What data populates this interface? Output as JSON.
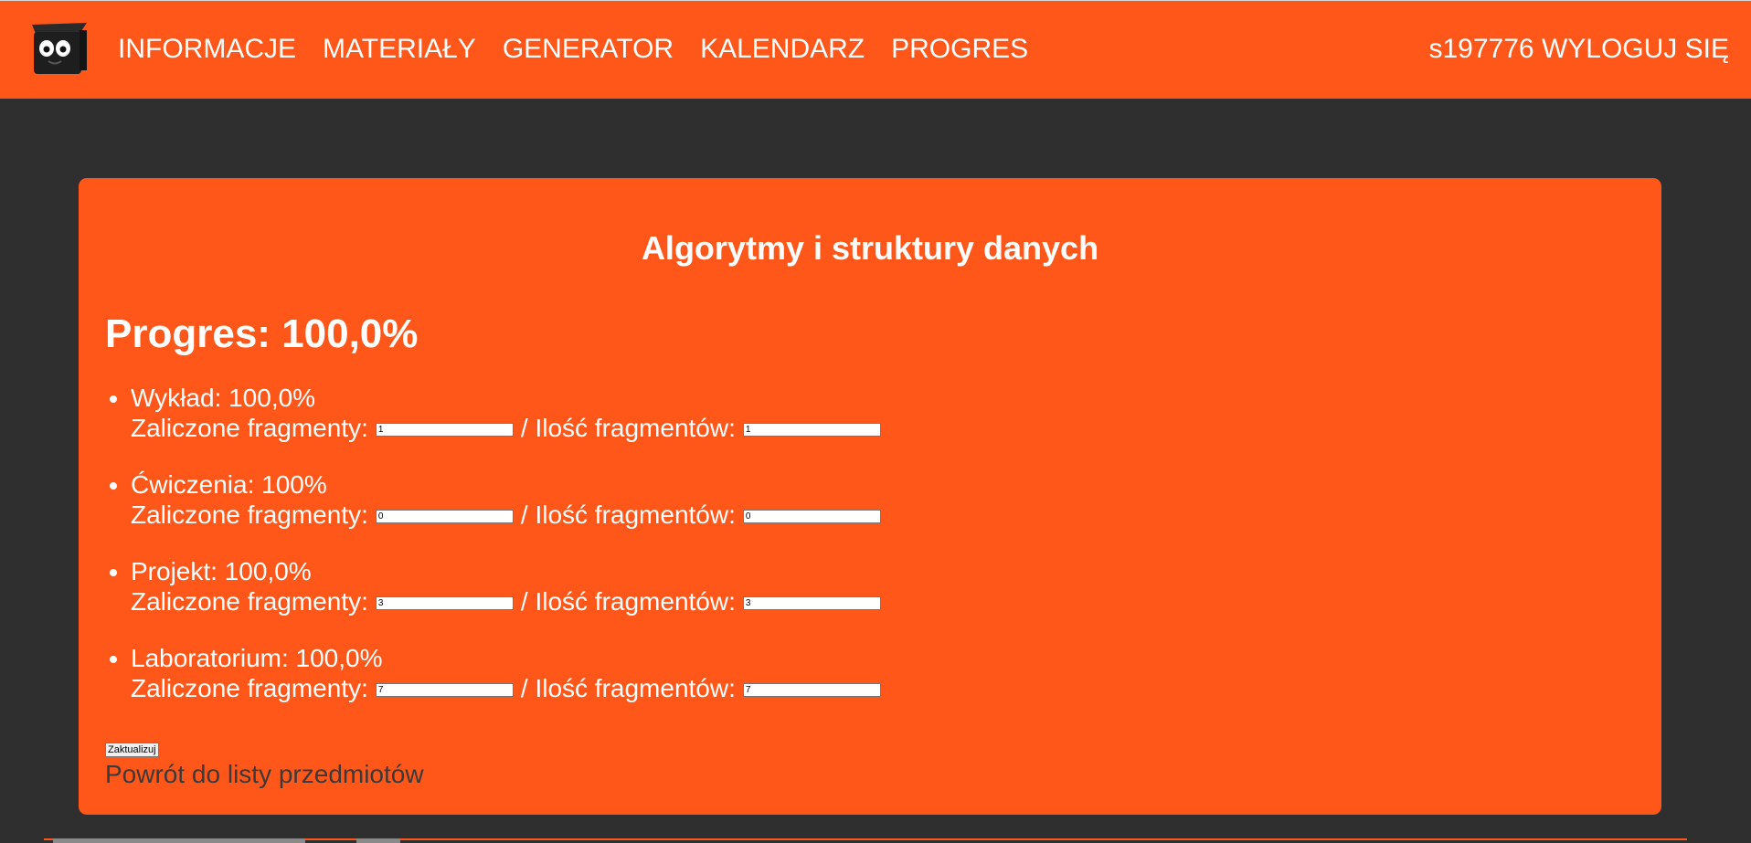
{
  "colors": {
    "accent": "#ff5719",
    "background": "#2f2f2f",
    "text_light": "#ffffff",
    "link_dark": "#3a3a3a"
  },
  "header": {
    "logo_icon": "owl-mascot-icon",
    "nav": [
      {
        "label": "INFORMACJE"
      },
      {
        "label": "MATERIAŁY"
      },
      {
        "label": "GENERATOR"
      },
      {
        "label": "KALENDARZ"
      },
      {
        "label": "PROGRES"
      }
    ],
    "user_id": "s197776",
    "logout_label": "WYLOGUJ SIĘ"
  },
  "course": {
    "title": "Algorytmy i struktury danych",
    "progress_heading": "Progres: 100,0%",
    "completed_label": "Zaliczone fragmenty:",
    "total_label": "/ Ilość fragmentów:",
    "components": [
      {
        "label": "Wykład: 100,0%",
        "completed": "1",
        "total": "1"
      },
      {
        "label": "Ćwiczenia: 100%",
        "completed": "0",
        "total": "0"
      },
      {
        "label": "Projekt: 100,0%",
        "completed": "3",
        "total": "3"
      },
      {
        "label": "Laboratorium: 100,0%",
        "completed": "7",
        "total": "7"
      }
    ],
    "update_button": "Zaktualizuj",
    "back_link": "Powrót do listy przedmiotów"
  }
}
